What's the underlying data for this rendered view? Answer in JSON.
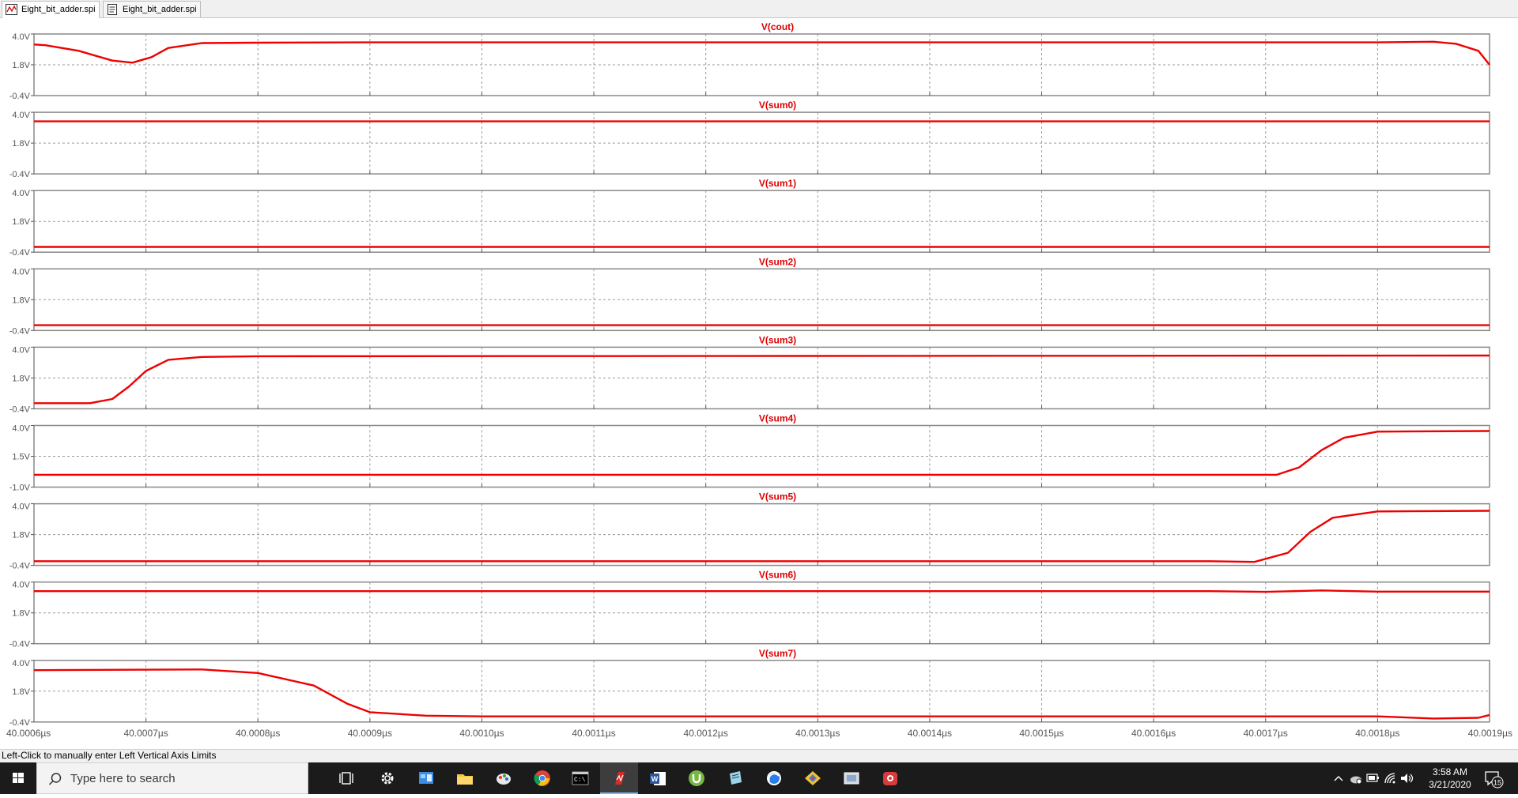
{
  "tabs": [
    {
      "label": "Eight_bit_adder.spi",
      "active": true,
      "icon": "waveform-icon"
    },
    {
      "label": "Eight_bit_adder.spi",
      "active": false,
      "icon": "netlist-icon"
    }
  ],
  "colors": {
    "trace": "#ee0000",
    "title": "#dd0000",
    "axis": "#555555",
    "grid": "#9a9a9a",
    "frame": "#888888"
  },
  "chart_data": {
    "type": "line",
    "x_axis": {
      "unit": "µs",
      "range": [
        40.0006,
        40.0019
      ],
      "ticks": [
        40.0006,
        40.0007,
        40.0008,
        40.0009,
        40.001,
        40.0011,
        40.0012,
        40.0013,
        40.0014,
        40.0015,
        40.0016,
        40.0017,
        40.0018,
        40.0019
      ],
      "tick_labels": [
        "40.0006µs",
        "40.0007µs",
        "40.0008µs",
        "40.0009µs",
        "40.0010µs",
        "40.0011µs",
        "40.0012µs",
        "40.0013µs",
        "40.0014µs",
        "40.0015µs",
        "40.0016µs",
        "40.0017µs",
        "40.0018µs",
        "40.0019µs"
      ]
    },
    "grid": true,
    "panes": [
      {
        "title": "V(cout)",
        "ylim": [
          -0.4,
          4.0
        ],
        "yticks": [
          "4.0V",
          "1.8V",
          "-0.4V"
        ],
        "x": [
          40.0006,
          40.00061,
          40.00064,
          40.00067,
          40.000688,
          40.000705,
          40.00072,
          40.00075,
          40.0008,
          40.0009,
          40.0012,
          40.0016,
          40.0018,
          40.00185,
          40.00187,
          40.00189,
          40.0019
        ],
        "y": [
          3.25,
          3.2,
          2.8,
          2.1,
          1.95,
          2.35,
          3.0,
          3.35,
          3.38,
          3.4,
          3.4,
          3.4,
          3.4,
          3.45,
          3.3,
          2.8,
          1.8
        ]
      },
      {
        "title": "V(sum0)",
        "ylim": [
          -0.4,
          4.0
        ],
        "yticks": [
          "4.0V",
          "1.8V",
          "-0.4V"
        ],
        "x": [
          40.0006,
          40.0019
        ],
        "y": [
          3.35,
          3.35
        ]
      },
      {
        "title": "V(sum1)",
        "ylim": [
          -0.4,
          4.0
        ],
        "yticks": [
          "4.0V",
          "1.8V",
          "-0.4V"
        ],
        "x": [
          40.0006,
          40.0019
        ],
        "y": [
          -0.02,
          -0.02
        ]
      },
      {
        "title": "V(sum2)",
        "ylim": [
          -0.4,
          4.0
        ],
        "yticks": [
          "4.0V",
          "1.8V",
          "-0.4V"
        ],
        "x": [
          40.0006,
          40.0019
        ],
        "y": [
          -0.02,
          -0.02
        ]
      },
      {
        "title": "V(sum3)",
        "ylim": [
          -0.4,
          4.0
        ],
        "yticks": [
          "4.0V",
          "1.8V",
          "-0.4V"
        ],
        "x": [
          40.0006,
          40.00065,
          40.00067,
          40.000685,
          40.0007,
          40.00072,
          40.00075,
          40.0008,
          40.0019
        ],
        "y": [
          0.0,
          0.0,
          0.3,
          1.2,
          2.3,
          3.1,
          3.3,
          3.35,
          3.4
        ]
      },
      {
        "title": "V(sum4)",
        "ylim": [
          -1.0,
          4.0
        ],
        "yticks": [
          "4.0V",
          "1.5V",
          "-1.0V"
        ],
        "x": [
          40.0006,
          40.00166,
          40.00171,
          40.00173,
          40.00175,
          40.00177,
          40.0018,
          40.0019
        ],
        "y": [
          0.0,
          0.0,
          0.0,
          0.6,
          2.0,
          3.0,
          3.5,
          3.55
        ]
      },
      {
        "title": "V(sum5)",
        "ylim": [
          -0.4,
          4.0
        ],
        "yticks": [
          "4.0V",
          "1.8V",
          "-0.4V"
        ],
        "x": [
          40.0006,
          40.00165,
          40.00169,
          40.00172,
          40.00174,
          40.00176,
          40.0018,
          40.0019
        ],
        "y": [
          -0.1,
          -0.1,
          -0.15,
          0.5,
          2.0,
          3.0,
          3.45,
          3.5
        ]
      },
      {
        "title": "V(sum6)",
        "ylim": [
          -0.4,
          4.0
        ],
        "yticks": [
          "4.0V",
          "1.8V",
          "-0.4V"
        ],
        "x": [
          40.0006,
          40.00165,
          40.0017,
          40.00175,
          40.0018,
          40.0019
        ],
        "y": [
          3.35,
          3.35,
          3.3,
          3.4,
          3.32,
          3.32
        ]
      },
      {
        "title": "V(sum7)",
        "ylim": [
          -0.4,
          4.0
        ],
        "yticks": [
          "4.0V",
          "1.8V",
          "-0.4V"
        ],
        "x": [
          40.0006,
          40.00075,
          40.0008,
          40.00085,
          40.00088,
          40.0009,
          40.00095,
          40.001,
          40.0018,
          40.00185,
          40.00189,
          40.0019
        ],
        "y": [
          3.3,
          3.35,
          3.1,
          2.2,
          0.9,
          0.3,
          0.05,
          0.0,
          0.0,
          -0.15,
          -0.1,
          0.1
        ]
      }
    ]
  },
  "status_text": "Left-Click to manually enter Left Vertical Axis Limits",
  "taskbar": {
    "search_placeholder": "Type here to search",
    "apps": [
      {
        "name": "task-view-icon",
        "active": false
      },
      {
        "name": "settings-gear-icon",
        "active": false
      },
      {
        "name": "control-panel-icon",
        "active": false
      },
      {
        "name": "file-explorer-icon",
        "active": false
      },
      {
        "name": "paint-icon",
        "active": false
      },
      {
        "name": "chrome-icon",
        "active": false
      },
      {
        "name": "terminal-icon",
        "active": false
      },
      {
        "name": "ltspice-icon",
        "active": true
      },
      {
        "name": "word-icon",
        "active": false
      },
      {
        "name": "utorrent-icon",
        "active": false
      },
      {
        "name": "notepad-icon",
        "active": false
      },
      {
        "name": "browser-icon",
        "active": false
      },
      {
        "name": "paint-net-icon",
        "active": false
      },
      {
        "name": "screenshot-icon",
        "active": false
      },
      {
        "name": "red-app-icon",
        "active": false
      }
    ],
    "clock_time": "3:58 AM",
    "clock_date": "3/21/2020",
    "notification_count": "15"
  }
}
